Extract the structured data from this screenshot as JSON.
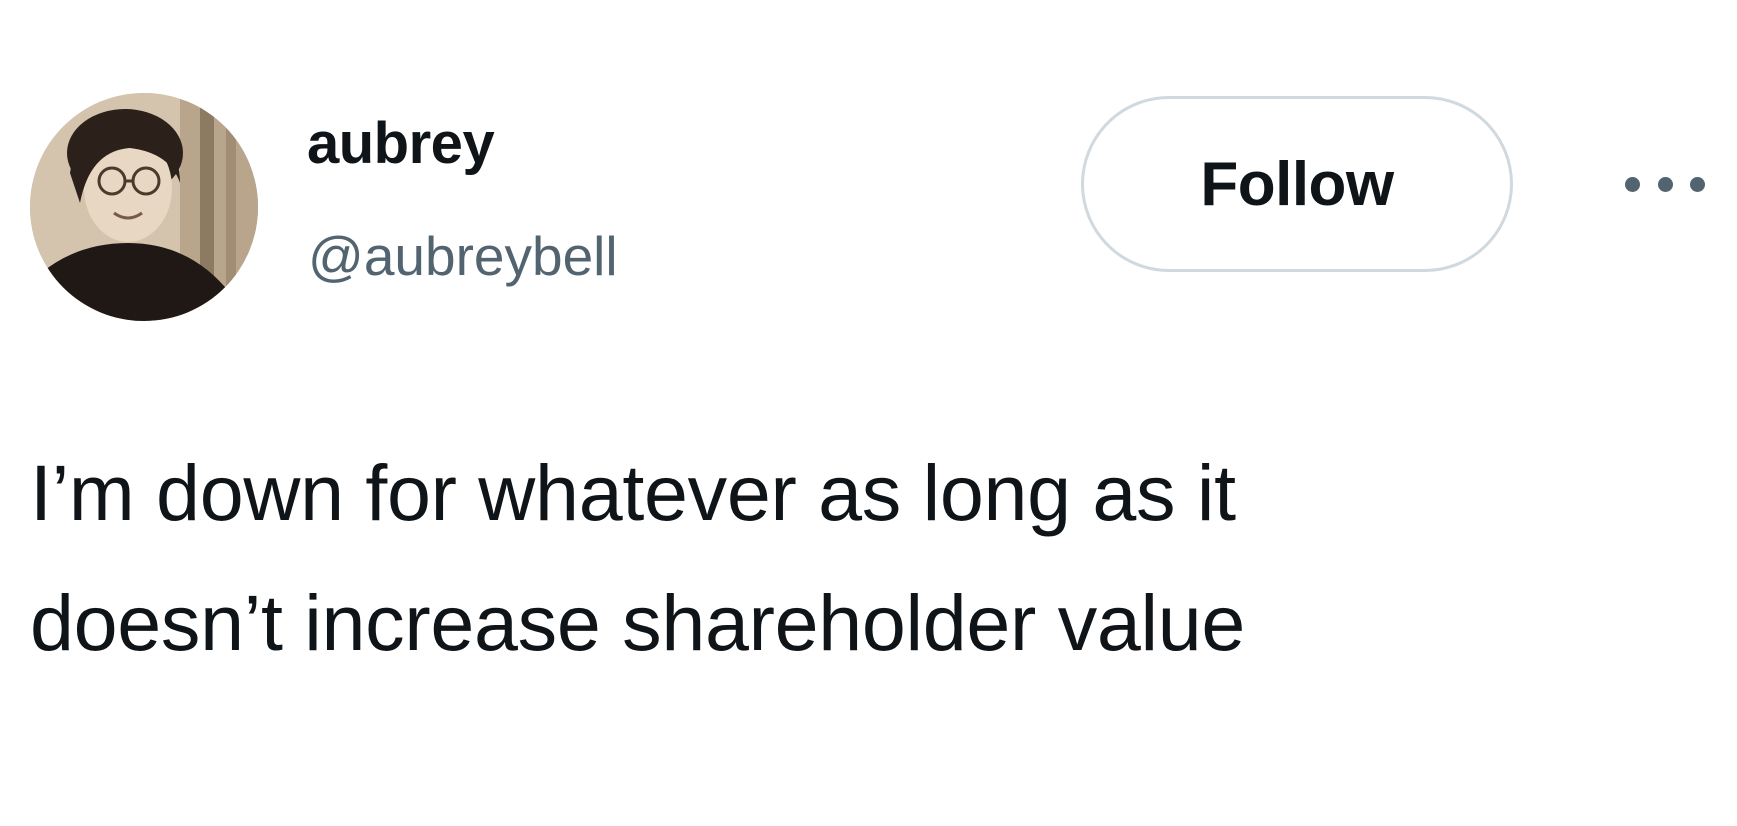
{
  "author": {
    "display_name": "aubrey",
    "handle": "@aubreybell",
    "avatar": "profile-photo"
  },
  "actions": {
    "follow_label": "Follow",
    "more_icon": "more-horizontal-icon"
  },
  "tweet": {
    "lines": [
      "I’m down for whatever as long as it",
      "doesn’t increase shareholder value"
    ]
  },
  "colors": {
    "text_primary": "#0f1419",
    "text_secondary": "#536471",
    "button_border": "#cfd9de",
    "background": "#ffffff"
  }
}
